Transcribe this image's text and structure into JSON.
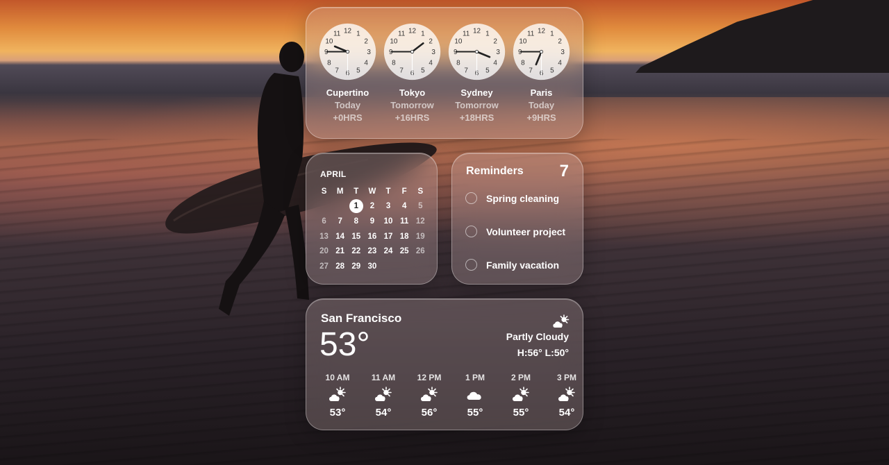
{
  "world_clock": {
    "clocks": [
      {
        "city": "Cupertino",
        "day": "Today",
        "offset": "+0HRS",
        "hour": 9,
        "minute": 45
      },
      {
        "city": "Tokyo",
        "day": "Tomorrow",
        "offset": "+16HRS",
        "hour": 1,
        "minute": 45
      },
      {
        "city": "Sydney",
        "day": "Tomorrow",
        "offset": "+18HRS",
        "hour": 3,
        "minute": 45
      },
      {
        "city": "Paris",
        "day": "Today",
        "offset": "+9HRS",
        "hour": 6,
        "minute": 45
      }
    ],
    "dial_numbers": [
      "12",
      "1",
      "2",
      "3",
      "4",
      "5",
      "6",
      "7",
      "8",
      "9",
      "10",
      "11"
    ]
  },
  "calendar": {
    "month": "APRIL",
    "weekdays": [
      "S",
      "M",
      "T",
      "W",
      "T",
      "F",
      "S"
    ],
    "leading_blanks": 2,
    "days": [
      "1",
      "2",
      "3",
      "4",
      "5",
      "6",
      "7",
      "8",
      "9",
      "10",
      "11",
      "12",
      "13",
      "14",
      "15",
      "16",
      "17",
      "18",
      "19",
      "20",
      "21",
      "22",
      "23",
      "24",
      "25",
      "26",
      "27",
      "28",
      "29",
      "30"
    ],
    "today": "1"
  },
  "reminders": {
    "title": "Reminders",
    "count": "7",
    "items": [
      "Spring cleaning",
      "Volunteer project",
      "Family vacation"
    ]
  },
  "weather": {
    "city": "San Francisco",
    "temp": "53°",
    "condition": "Partly Cloudy",
    "high_low": "H:56° L:50°",
    "condition_icon": "partly-sunny-icon",
    "hourly": [
      {
        "time": "10 AM",
        "icon": "partly-sunny-icon",
        "temp": "53°"
      },
      {
        "time": "11 AM",
        "icon": "partly-sunny-icon",
        "temp": "54°"
      },
      {
        "time": "12 PM",
        "icon": "partly-sunny-icon",
        "temp": "56°"
      },
      {
        "time": "1 PM",
        "icon": "cloud-icon",
        "temp": "55°"
      },
      {
        "time": "2 PM",
        "icon": "partly-sunny-icon",
        "temp": "55°"
      },
      {
        "time": "3 PM",
        "icon": "partly-sunny-icon",
        "temp": "54°"
      }
    ]
  }
}
